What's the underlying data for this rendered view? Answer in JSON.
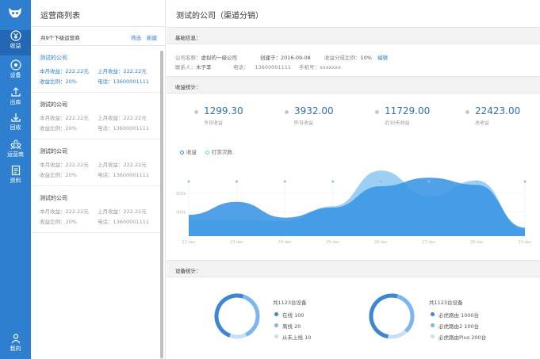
{
  "nav": {
    "items": [
      {
        "label": "收益",
        "icon": "yen-icon"
      },
      {
        "label": "设备",
        "icon": "device-icon"
      },
      {
        "label": "出库",
        "icon": "upload-icon"
      },
      {
        "label": "回收",
        "icon": "download-icon"
      },
      {
        "label": "运营商",
        "icon": "operator-icon"
      },
      {
        "label": "资料",
        "icon": "document-icon"
      }
    ],
    "me": {
      "label": "我的",
      "icon": "user-icon"
    }
  },
  "list": {
    "title": "运营商列表",
    "count_text": "共9个下级运营商",
    "filter_label": "筛选",
    "create_label": "新建",
    "cards": [
      {
        "name": "测试的公司",
        "month_income": "本月收益：222.22元",
        "last_month_income": "上月收益：222.22元",
        "ratio": "收益比例：20%",
        "phone": "电话：13600001111"
      },
      {
        "name": "测试的公司",
        "month_income": "本月收益：222.22元",
        "last_month_income": "上月收益：222.22元",
        "ratio": "收益比例：20%",
        "phone": "电话：13600001111"
      },
      {
        "name": "测试的公司",
        "month_income": "本月收益：222.22元",
        "last_month_income": "上月收益：222.22元",
        "ratio": "收益比例：20%",
        "phone": "电话：13600001111"
      },
      {
        "name": "测试的公司",
        "month_income": "本月收益：222.22元",
        "last_month_income": "上月收益：222.22元",
        "ratio": "收益比例：20%",
        "phone": "电话：13600001111"
      }
    ]
  },
  "main": {
    "title": "测试的公司（渠道分销）",
    "basic_header": "基础信息：",
    "basic": {
      "company_label": "公司名称：",
      "company": "虚拟的一级公司",
      "created_label": "创建于：",
      "created": "2016-09-08",
      "ratio_label": "收益分成比例：",
      "ratio": "10%",
      "edit_label": "编辑",
      "contact_label": "联系人：",
      "contact": "木子李",
      "phone_label": "电话：",
      "phone": "13600001111",
      "mobile_label": "手机号：",
      "mobile": "xxxxxxx"
    },
    "income_header": "收益统计：",
    "stats": [
      {
        "value": "1299.30",
        "label": "今日收益"
      },
      {
        "value": "3932.00",
        "label": "昨日收益"
      },
      {
        "value": "11729.00",
        "label": "近30天收益"
      },
      {
        "value": "22423.00",
        "label": "总收益"
      }
    ],
    "legend": [
      {
        "label": "收益",
        "color": "#2f8ee8"
      },
      {
        "label": "打赏次数",
        "color": "#6dd3c3"
      }
    ],
    "device_header": "设备统计：",
    "devices": [
      {
        "total": "共1123台设备",
        "rows": [
          {
            "label": "在线  100",
            "color": "#3d86d2"
          },
          {
            "label": "离线  20",
            "color": "#7bb7ec"
          },
          {
            "label": "从未上线  10",
            "color": "#c7dff6"
          }
        ]
      },
      {
        "total": "共1123台设备",
        "rows": [
          {
            "label": "必虎路由  1000台",
            "color": "#3d86d2"
          },
          {
            "label": "必虎路由2  100台",
            "color": "#7bb7ec"
          },
          {
            "label": "必虎路由Plus  200台",
            "color": "#c7dff6"
          }
        ]
      }
    ]
  },
  "chart_data": {
    "type": "area",
    "x": [
      "22 dec",
      "23 dec",
      "24 dec",
      "25 dec",
      "26 dec",
      "27 dec",
      "28 dec",
      "29 dec"
    ],
    "y_ticks": [
      "400k",
      "600k"
    ],
    "series": [
      {
        "name": "收益",
        "color": "#3d97e6",
        "values": [
          300,
          480,
          260,
          400,
          700,
          820,
          720,
          120
        ]
      },
      {
        "name": "打赏次数",
        "color": "#8cc7f2",
        "values": [
          230,
          230,
          210,
          420,
          920,
          560,
          780,
          90
        ]
      }
    ],
    "legend": "top-left",
    "grid": true
  }
}
